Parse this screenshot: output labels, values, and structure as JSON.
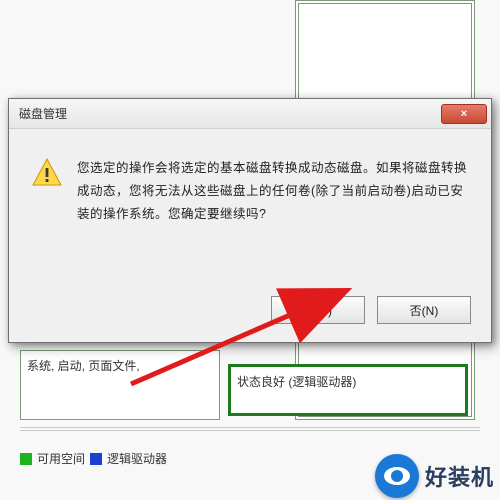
{
  "dialog": {
    "title": "磁盘管理",
    "message": "您选定的操作会将选定的基本磁盘转换成动态磁盘。如果将磁盘转换成动态，您将无法从这些磁盘上的任何卷(除了当前启动卷)启动已安装的操作系统。您确定要继续吗?",
    "yes_label": "是(Y)",
    "no_label": "否(N)",
    "close_label": "×"
  },
  "background": {
    "left_box_text": "系统, 启动, 页面文件,",
    "right_box_text": "状态良好 (逻辑驱动器)",
    "legend_available": "可用空间",
    "legend_logical": "逻辑驱动器"
  },
  "watermark": {
    "text": "好装机"
  },
  "colors": {
    "accent_green": "#1fb21f",
    "accent_blue": "#1f3fd0",
    "arrow_red": "#e11b1b",
    "brand_blue": "#1a78d6"
  }
}
